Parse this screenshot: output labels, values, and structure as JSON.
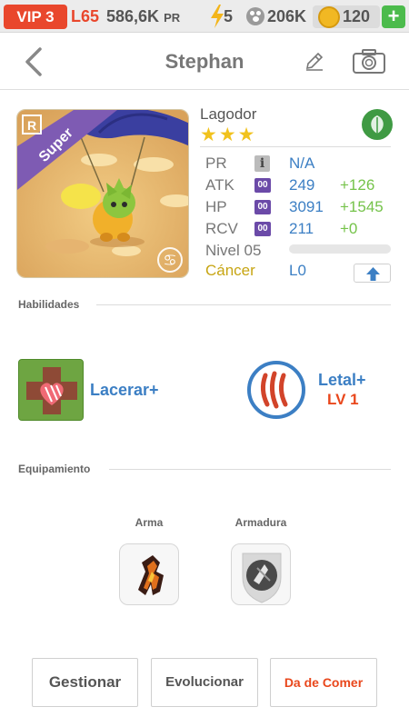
{
  "status_bar": {
    "vip": "VIP 3",
    "level": "L65",
    "power_value": "586,6K",
    "power_unit": "PR",
    "energy": "5",
    "coins": "206K",
    "gems": "120",
    "add": "+",
    "icons": [
      "bolt-icon",
      "paw-icon",
      "gem-icon"
    ]
  },
  "header": {
    "title": "Stephan",
    "icons": [
      "back-arrow-icon",
      "pencil-icon",
      "camera-icon"
    ]
  },
  "monster": {
    "rarity_tag": "Super",
    "rarity_badge": "R",
    "name": "Lagodor",
    "stars": "★★★",
    "element_icon": "leaf-icon",
    "stats": [
      {
        "label": "PR",
        "badge": "i",
        "value": "N/A",
        "bonus": ""
      },
      {
        "label": "ATK",
        "badge": "00",
        "value": "249",
        "bonus": "+126"
      },
      {
        "label": "HP",
        "badge": "00",
        "value": "3091",
        "bonus": "+1545"
      },
      {
        "label": "RCV",
        "badge": "00",
        "value": "211",
        "bonus": "+0"
      }
    ],
    "level_text": "Nivel 05",
    "level_progress": 0,
    "sign": "Cáncer",
    "sign_level": "L0",
    "upgrade_icon": "arrow-up-icon"
  },
  "skills": {
    "title": "Habilidades",
    "items": [
      {
        "label": "Lacerar+",
        "level": ""
      },
      {
        "label": "Letal+",
        "level": "LV 1"
      }
    ]
  },
  "equipment": {
    "title": "Equipamiento",
    "slots": [
      {
        "label": "Arma"
      },
      {
        "label": "Armadura"
      }
    ]
  },
  "actions": {
    "manage": "Gestionar",
    "evolve": "Evolucionar",
    "feed": "Da de Comer"
  },
  "colors": {
    "vip_red": "#e9472c",
    "stat_blue": "#3c7fc4",
    "bonus_green": "#75c34a",
    "sign_gold": "#c7a513",
    "feed_orange": "#e9471c"
  }
}
